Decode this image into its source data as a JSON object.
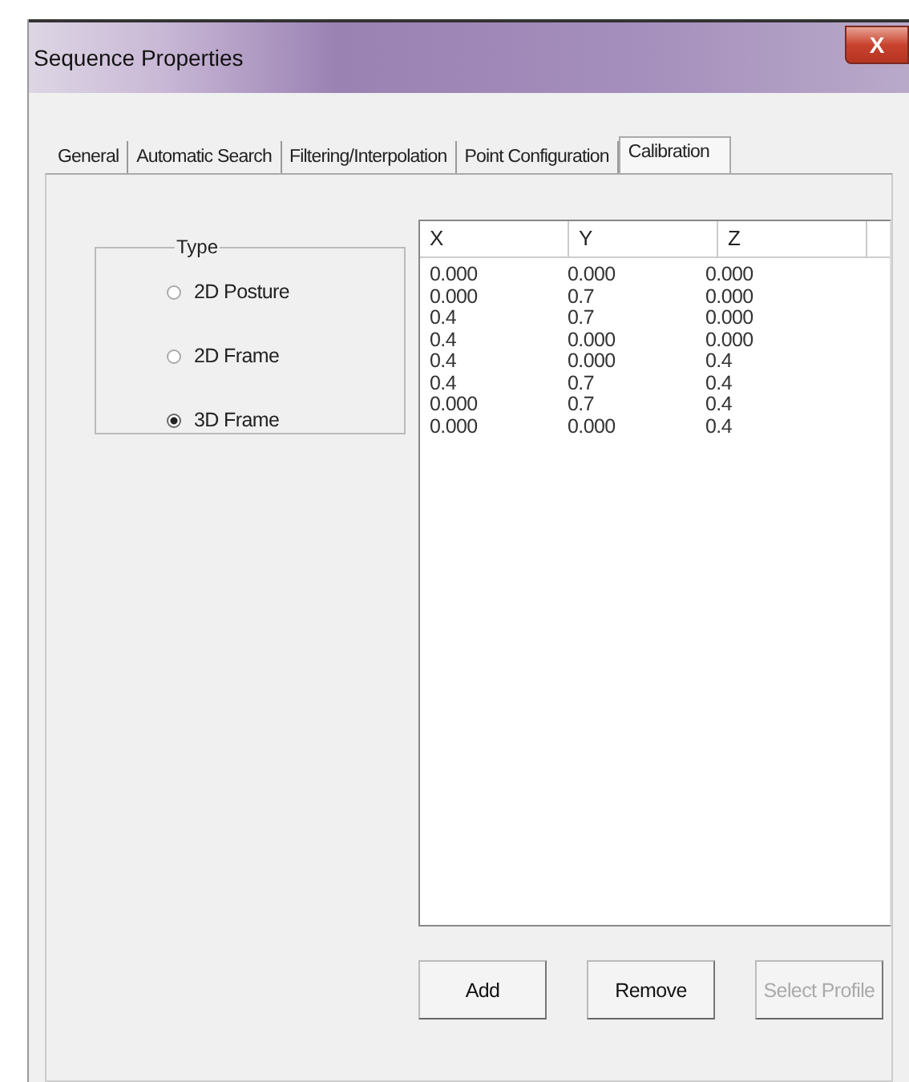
{
  "window": {
    "title": "Sequence Properties",
    "close": "X"
  },
  "tabs": [
    {
      "label": "General",
      "selected": false
    },
    {
      "label": "Automatic Search",
      "selected": false
    },
    {
      "label": "Filtering/Interpolation",
      "selected": false
    },
    {
      "label": "Point Configuration",
      "selected": false
    },
    {
      "label": "Calibration",
      "selected": true
    }
  ],
  "type_group": {
    "title": "Type",
    "options": [
      {
        "label": "2D Posture",
        "selected": false
      },
      {
        "label": "2D Frame",
        "selected": false
      },
      {
        "label": "3D Frame",
        "selected": true
      }
    ]
  },
  "table": {
    "columns": [
      "X",
      "Y",
      "Z"
    ],
    "rows": [
      [
        "0.000",
        "0.000",
        "0.000"
      ],
      [
        "0.000",
        "0.7",
        "0.000"
      ],
      [
        "0.4",
        "0.7",
        "0.000"
      ],
      [
        "0.4",
        "0.000",
        "0.000"
      ],
      [
        "0.4",
        "0.000",
        "0.4"
      ],
      [
        "0.4",
        "0.7",
        "0.4"
      ],
      [
        "0.000",
        "0.7",
        "0.4"
      ],
      [
        "0.000",
        "0.000",
        "0.4"
      ]
    ]
  },
  "buttons": [
    {
      "label": "Add",
      "disabled": false
    },
    {
      "label": "Remove",
      "disabled": false
    },
    {
      "label": "Select Profile",
      "disabled": true
    }
  ]
}
